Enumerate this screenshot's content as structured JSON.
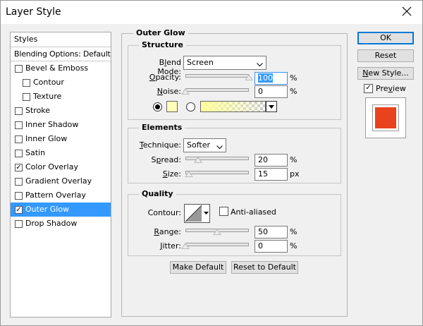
{
  "window": {
    "title": "Layer Style"
  },
  "styles_panel": {
    "header": "Styles",
    "blending_options": "Blending Options: Default",
    "items": [
      {
        "label": "Bevel & Emboss",
        "checked": false,
        "sub": false,
        "selected": false
      },
      {
        "label": "Contour",
        "checked": false,
        "sub": true,
        "selected": false
      },
      {
        "label": "Texture",
        "checked": false,
        "sub": true,
        "selected": false
      },
      {
        "label": "Stroke",
        "checked": false,
        "sub": false,
        "selected": false
      },
      {
        "label": "Inner Shadow",
        "checked": false,
        "sub": false,
        "selected": false
      },
      {
        "label": "Inner Glow",
        "checked": false,
        "sub": false,
        "selected": false
      },
      {
        "label": "Satin",
        "checked": false,
        "sub": false,
        "selected": false
      },
      {
        "label": "Color Overlay",
        "checked": true,
        "sub": false,
        "selected": false
      },
      {
        "label": "Gradient Overlay",
        "checked": false,
        "sub": false,
        "selected": false
      },
      {
        "label": "Pattern Overlay",
        "checked": false,
        "sub": false,
        "selected": false
      },
      {
        "label": "Outer Glow",
        "checked": true,
        "sub": false,
        "selected": true
      },
      {
        "label": "Drop Shadow",
        "checked": false,
        "sub": false,
        "selected": false
      }
    ]
  },
  "outer_glow": {
    "title": "Outer Glow",
    "structure": {
      "title": "Structure",
      "blend_mode_label_pre": "B",
      "blend_mode_label_u": "l",
      "blend_mode_label_post": "end Mode:",
      "blend_mode": "Screen",
      "opacity_label_u": "O",
      "opacity_label_post": "pacity:",
      "opacity": "100",
      "opacity_level": 1.0,
      "opacity_unit": "%",
      "noise_label_u": "N",
      "noise_label_post": "oise:",
      "noise": "0",
      "noise_level": 0.0,
      "noise_unit": "%",
      "color_swatch": "#ffffb8",
      "gradient_start": "#ffff99"
    },
    "elements": {
      "title": "Elements",
      "technique_label_u": "T",
      "technique_label_post": "echnique:",
      "technique": "Softer",
      "spread_label_pre": "S",
      "spread_label_u": "p",
      "spread_label_post": "read:",
      "spread": "20",
      "spread_level": 0.2,
      "spread_unit": "%",
      "size_label_u": "S",
      "size_label_post": "ize:",
      "size": "15",
      "size_level": 0.06,
      "size_unit": "px"
    },
    "quality": {
      "title": "Quality",
      "contour_label": "Contour:",
      "anti_aliased_label": "Anti-aliased",
      "anti_aliased": false,
      "range_label_u": "R",
      "range_label_post": "ange:",
      "range": "50",
      "range_level": 0.5,
      "range_unit": "%",
      "jitter_label_u": "J",
      "jitter_label_post": "itter:",
      "jitter": "0",
      "jitter_level": 0.0,
      "jitter_unit": "%"
    },
    "make_default": "Make Default",
    "reset_to_default": "Reset to Default"
  },
  "buttons": {
    "ok": "OK",
    "reset": "Reset",
    "new_style_u": "N",
    "new_style_post": "ew Style...",
    "preview_u": "v",
    "preview_pre": "Pre",
    "preview_post": "iew",
    "preview_checked": true
  },
  "preview": {
    "color": "#e8431c"
  },
  "colors": {
    "selection": "#3399ff",
    "ok_border": "#0078d7"
  }
}
